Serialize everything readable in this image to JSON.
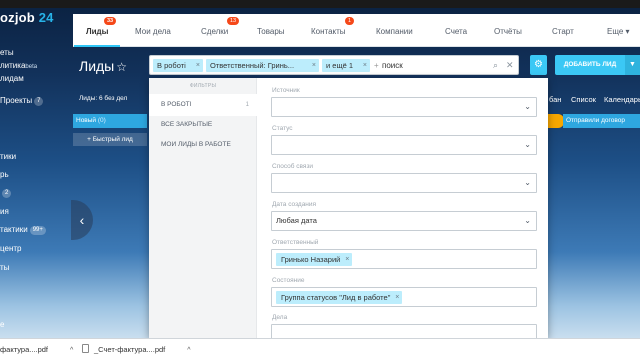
{
  "app": {
    "logo_name": "ozjob",
    "logo_num": "24"
  },
  "topnav": {
    "tabs": [
      {
        "label": "Лиды",
        "badge": "33"
      },
      {
        "label": "Мои дела",
        "badge": ""
      },
      {
        "label": "Сделки",
        "badge": "13"
      },
      {
        "label": "Товары",
        "badge": ""
      },
      {
        "label": "Контакты",
        "badge": "1"
      },
      {
        "label": "Компании",
        "badge": ""
      },
      {
        "label": "Счета",
        "badge": ""
      },
      {
        "label": "Отчёты",
        "badge": ""
      },
      {
        "label": "Старт",
        "badge": ""
      },
      {
        "label": "Еще",
        "badge": ""
      }
    ]
  },
  "leftnav": {
    "items": [
      {
        "label": "еты"
      },
      {
        "label": "литика",
        "suffix": "beta"
      },
      {
        "label": "лидам"
      },
      {
        "label": "Проекты",
        "count": "7"
      },
      {
        "label": "тики"
      },
      {
        "label": "рь"
      },
      {
        "label": "",
        "count": "2"
      },
      {
        "label": "ия"
      },
      {
        "label": "тактики",
        "count": "99+"
      },
      {
        "label": "центр"
      },
      {
        "label": "ты"
      },
      {
        "label": "е"
      }
    ]
  },
  "page": {
    "title": "Лиды",
    "leads_label": "Лиды:",
    "leads_count": "6",
    "leads_suffix": "без дел",
    "column_title": "Новый",
    "column_count": "(0)",
    "quick_lead": "+ Быстрый лид"
  },
  "filter": {
    "chips": [
      {
        "label": "В роботі"
      },
      {
        "label": "Ответственный: Гринь..."
      },
      {
        "label": "и ещё 1"
      }
    ],
    "search_prefix": "+",
    "search_value": "поиск",
    "settings_icon": "gear-icon",
    "add_button": "ДОБАВИТЬ ЛИД",
    "add_dropdown": "▼"
  },
  "views": {
    "tabs": [
      {
        "label": "бан"
      },
      {
        "label": "Список"
      },
      {
        "label": "Календарь"
      }
    ],
    "right_column_title": "Отправили договор"
  },
  "panel": {
    "title": "ФИЛЬТРЫ",
    "presets": [
      {
        "label": "В РОБОТІ",
        "count": "1"
      },
      {
        "label": "ВСЕ ЗАКРЫТЫЕ",
        "count": ""
      },
      {
        "label": "МОИ ЛИДЫ В РАБОТЕ",
        "count": ""
      }
    ],
    "fields": [
      {
        "label": "Источник",
        "value": ""
      },
      {
        "label": "Статус",
        "value": ""
      },
      {
        "label": "Способ связи",
        "value": ""
      },
      {
        "label": "Дата создания",
        "value": "Любая дата"
      },
      {
        "label": "Ответственный",
        "chip": "Гринько Назарий"
      },
      {
        "label": "Состояние",
        "chip": "Группа статусов \"Лид в работе\""
      },
      {
        "label": "Дела",
        "value": ""
      }
    ]
  },
  "downloads": [
    {
      "name": "фактура....pdf"
    },
    {
      "name": "_Счет-фактура....pdf"
    }
  ],
  "colors": {
    "accent": "#3bc8f5",
    "chip": "#bcedfc",
    "badge": "#f54819"
  }
}
